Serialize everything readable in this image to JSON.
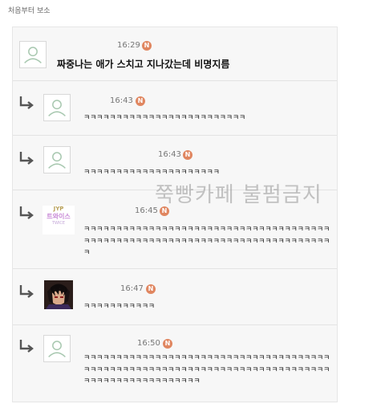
{
  "breadcrumb": "처음부터 보소",
  "watermark": "쭉빵카페 불펌금지",
  "jyp_badge": {
    "line1": "JYP",
    "line2": "트와이스",
    "line3": "TWICE"
  },
  "colors": {
    "badge": "#e08660",
    "card_bg": "#f7f7f7"
  },
  "comments": [
    {
      "time": "16:29",
      "badge": "N",
      "text": "짜중나는 애가 스치고 지나갔는데 비명지름"
    },
    {
      "time": "16:43",
      "badge": "N",
      "text": "ㅋㅋㅋㅋㅋㅋㅋㅋㅋㅋㅋㅋㅋㅋㅋㅋㅋㅋㅋㅋㅋㅋㅋㅋㅋ"
    },
    {
      "time": "16:43",
      "badge": "N",
      "text": "ㅋㅋㅋㅋㅋㅋㅋㅋㅋㅋㅋㅋㅋㅋㅋㅋㅋㅋㅋㅋㅋ"
    },
    {
      "time": "16:45",
      "badge": "N",
      "text": "ㅋㅋㅋㅋㅋㅋㅋㅋㅋㅋㅋㅋㅋㅋㅋㅋㅋㅋㅋㅋㅋㅋㅋㅋㅋㅋㅋㅋㅋㅋㅋㅋㅋㅋㅋㅋㅋㅋㅋㅋㅋㅋㅋㅋㅋㅋㅋㅋㅋㅋㅋㅋㅋㅋㅋㅋㅋㅋㅋㅋㅋㅋㅋㅋㅋㅋㅋㅋㅋㅋㅋㅋㅋㅋㅋㅋㅋ"
    },
    {
      "time": "16:47",
      "badge": "N",
      "text": "ㅋㅋㅋㅋㅋㅋㅋㅋㅋㅋㅋ"
    },
    {
      "time": "16:50",
      "badge": "N",
      "text": "ㅋㅋㅋㅋㅋㅋㅋㅋㅋㅋㅋㅋㅋㅋㅋㅋㅋㅋㅋㅋㅋㅋㅋㅋㅋㅋㅋㅋㅋㅋㅋㅋㅋㅋㅋㅋㅋㅋㅋㅋㅋㅋㅋㅋㅋㅋㅋㅋㅋㅋㅋㅋㅋㅋㅋㅋㅋㅋㅋㅋㅋㅋㅋㅋㅋㅋㅋㅋㅋㅋㅋㅋㅋㅋㅋㅋㅋㅋㅋㅋㅋㅋㅋㅋㅋㅋㅋㅋㅋㅋㅋㅋㅋㅋ"
    }
  ]
}
